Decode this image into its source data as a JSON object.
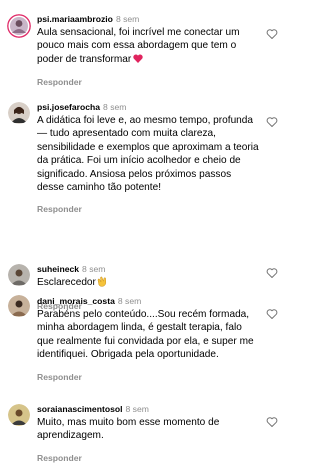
{
  "comments": [
    {
      "username": "psi.mariaambrozio",
      "time": "8 sem",
      "text": "Aula sensacional, foi incrível me conectar um pouco mais com essa abordagem que tem o poder de transformar",
      "emoji": "red-heart-emoji",
      "reply": "Responder"
    },
    {
      "username": "psi.josefarocha",
      "time": "8 sem",
      "text": "A didática foi leve e, ao mesmo tempo, profunda — tudo apresentado com muita clareza, sensibilidade e exemplos que aproximam a teoria da prática. Foi um início acolhedor e cheio de significado. Ansiosa pelos próximos passos desse caminho tão potente!",
      "reply": "Responder"
    },
    {
      "username": "suheineck",
      "time": "8 sem",
      "text": "Esclarecedor",
      "emoji": "clapping-hands-emoji",
      "reply": "Responder"
    },
    {
      "username": "dani_morais_costa",
      "time": "8 sem",
      "text": "Parabéns pelo conteúdo....Sou recém formada, minha abordagem linda, é gestalt terapia, falo que realmente fui convidada por ela, e super me identifiquei. Obrigada pela oportunidade.",
      "reply": "Responder"
    },
    {
      "username": "soraianascimentosol",
      "time": "8 sem",
      "text": "Muito, mas muito bom esse momento de aprendizagem.",
      "reply": "Responder"
    }
  ],
  "icons": {
    "like": "heart-outline-icon"
  },
  "colors": {
    "text": "#000000",
    "secondary": "#8e8e8e",
    "heart_emoji": "#e0245e",
    "clap_emoji": "#f5c33b",
    "story_ring": "#e1306c"
  }
}
